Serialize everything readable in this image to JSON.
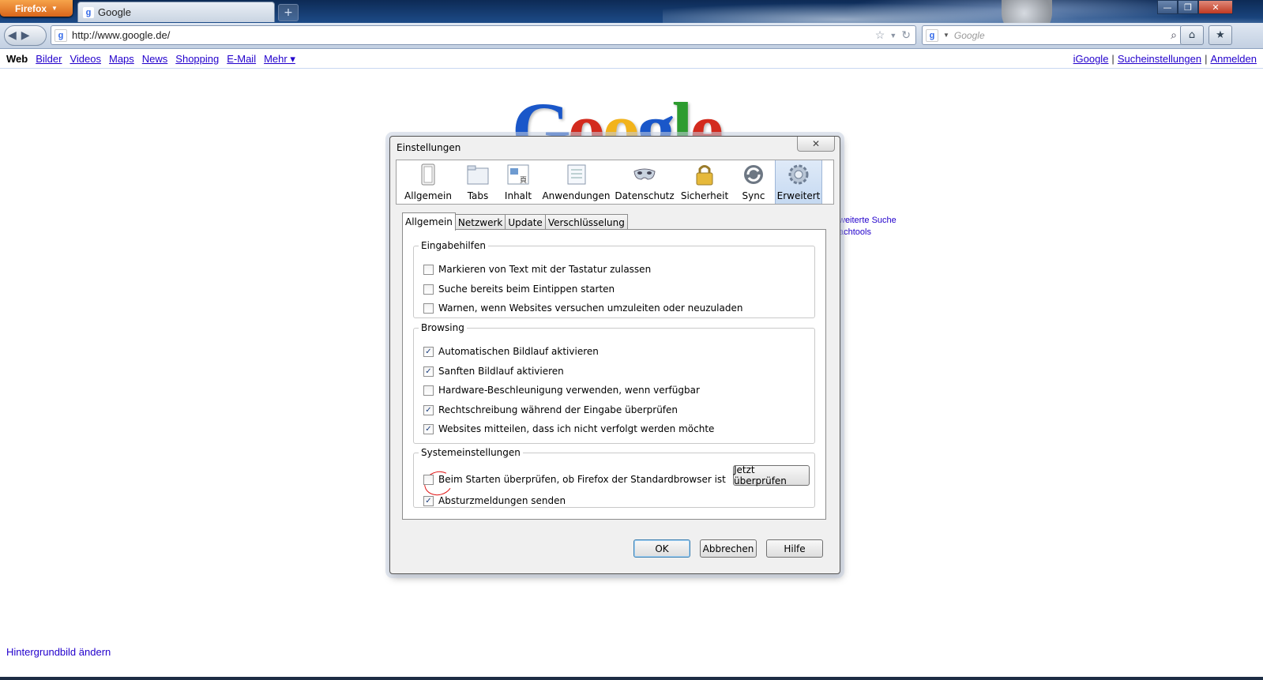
{
  "browser": {
    "menu_button": "Firefox",
    "tab_title": "Google",
    "url": "http://www.google.de/",
    "search_placeholder": "Google"
  },
  "google_bar": {
    "left_links": [
      "Web",
      "Bilder",
      "Videos",
      "Maps",
      "News",
      "Shopping",
      "E-Mail",
      "Mehr ▾"
    ],
    "right_links": [
      "iGoogle",
      "Sucheinstellungen",
      "Anmelden"
    ],
    "separator": "|"
  },
  "page": {
    "logo": [
      "G",
      "o",
      "o",
      "g",
      "l",
      "e"
    ],
    "side_links": [
      "weiterte Suche",
      "achtools"
    ],
    "background_link": "Hintergrundbild ändern"
  },
  "dialog": {
    "title": "Einstellungen",
    "close_glyph": "✕",
    "panes": [
      "Allgemein",
      "Tabs",
      "Inhalt",
      "Anwendungen",
      "Datenschutz",
      "Sicherheit",
      "Sync",
      "Erweitert"
    ],
    "selected_pane": "Erweitert",
    "tabs": [
      "Allgemein",
      "Netzwerk",
      "Update",
      "Verschlüsselung"
    ],
    "selected_tab": "Allgemein",
    "groups": {
      "eingabehilfen": {
        "title": "Eingabehilfen",
        "items": [
          {
            "label": "Markieren von Text mit der Tastatur zulassen",
            "checked": false
          },
          {
            "label": "Suche bereits beim Eintippen starten",
            "checked": false
          },
          {
            "label": "Warnen, wenn Websites versuchen umzuleiten oder neuzuladen",
            "checked": false
          }
        ]
      },
      "browsing": {
        "title": "Browsing",
        "items": [
          {
            "label": "Automatischen Bildlauf aktivieren",
            "checked": true
          },
          {
            "label": "Sanften Bildlauf aktivieren",
            "checked": true
          },
          {
            "label": "Hardware-Beschleunigung verwenden, wenn verfügbar",
            "checked": false
          },
          {
            "label": "Rechtschreibung während der Eingabe überprüfen",
            "checked": true
          },
          {
            "label": "Websites mitteilen, dass ich nicht verfolgt werden möchte",
            "checked": true
          }
        ]
      },
      "system": {
        "title": "Systemeinstellungen",
        "items": [
          {
            "label": "Beim Starten überprüfen, ob Firefox der Standardbrowser ist",
            "checked": false
          },
          {
            "label": "Absturzmeldungen senden",
            "checked": true
          }
        ],
        "check_now_button": "Jetzt überprüfen"
      }
    },
    "buttons": {
      "ok": "OK",
      "cancel": "Abbrechen",
      "help": "Hilfe"
    }
  }
}
